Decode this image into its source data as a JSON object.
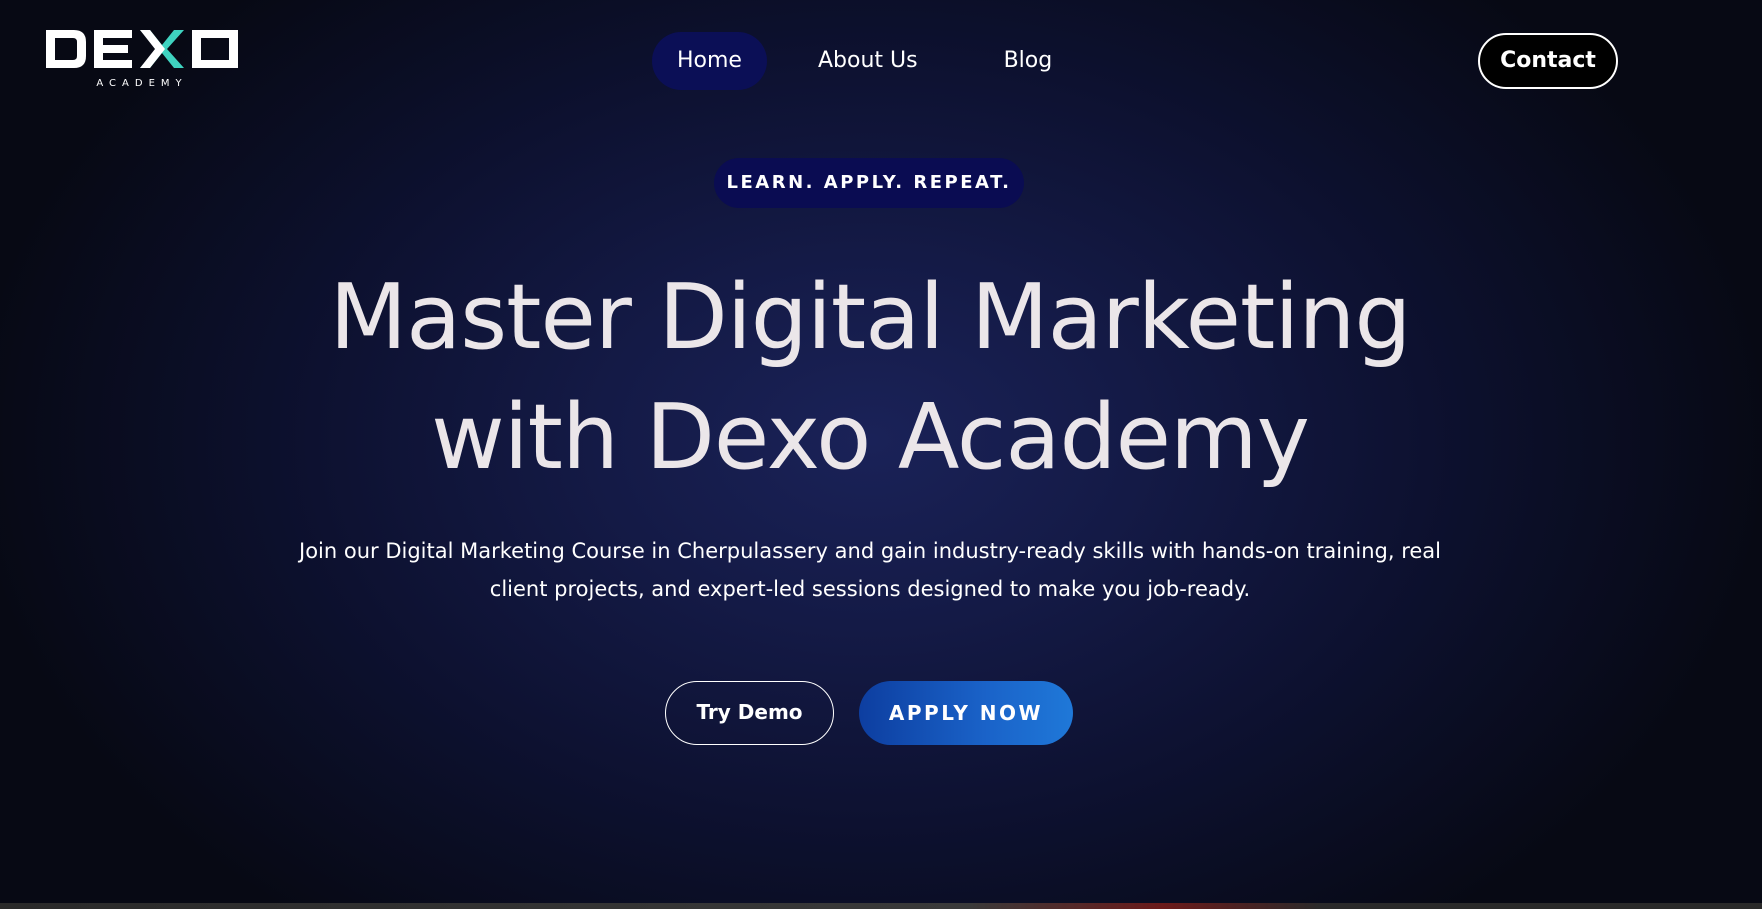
{
  "logo": {
    "wordmark": "DEXO",
    "subtitle": "ACADEMY",
    "accent_color": "#3fd3c0"
  },
  "nav": {
    "items": [
      {
        "label": "Home",
        "active": true
      },
      {
        "label": "About Us",
        "active": false
      },
      {
        "label": "Blog",
        "active": false
      }
    ],
    "contact_label": "Contact"
  },
  "hero": {
    "tagline": "LEARN. APPLY. REPEAT.",
    "headline_line1": "Master Digital Marketing",
    "headline_line2": "with Dexo Academy",
    "description": "Join our Digital Marketing Course in Cherpulassery and gain industry-ready skills with hands-on training, real client projects, and expert-led sessions designed to make you job-ready.",
    "try_demo_label": "Try Demo",
    "apply_label": "APPLY NOW"
  },
  "colors": {
    "background": "#070914",
    "nav_active": "#0b0f56",
    "tagline_bg": "#0a0c52",
    "apply_gradient_start": "#0d3ea0",
    "apply_gradient_end": "#1f78d8",
    "headline_text": "#ebe6e9"
  }
}
